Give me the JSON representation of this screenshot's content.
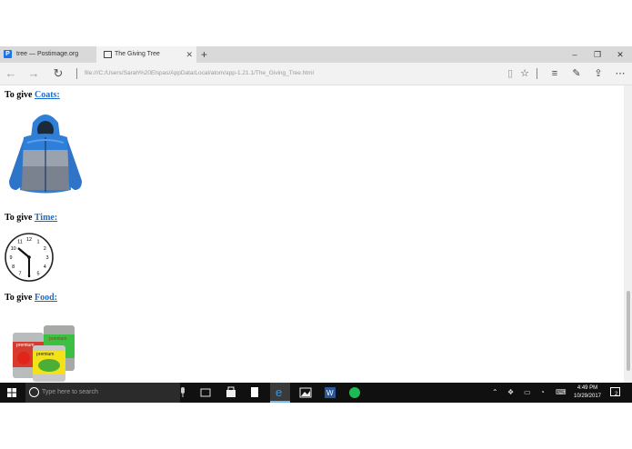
{
  "tabs": [
    {
      "title": "tree — Postimage.org",
      "icon": "postimage-icon"
    },
    {
      "title": "The Giving Tree",
      "icon": "page-icon"
    }
  ],
  "address": {
    "url": "file:///C:/Users/Sarah%20Elspas/AppData/Local/atom/app-1.21.1/The_Giving_Tree.html"
  },
  "sections": [
    {
      "prefix": "To give ",
      "link": "Coats:",
      "image": "coat-image"
    },
    {
      "prefix": "To give ",
      "link": "Time:",
      "image": "clock-image"
    },
    {
      "prefix": "To give ",
      "link": "Food:",
      "image": "canned-food-image"
    }
  ],
  "clock_face": [
    "12",
    "1",
    "2",
    "3",
    "4",
    "5",
    "6",
    "7",
    "8",
    "9",
    "10",
    "11"
  ],
  "can_label": "premium",
  "taskbar": {
    "search_placeholder": "Type here to search",
    "time": "4:49 PM",
    "date": "10/29/2017",
    "notification_count": "2"
  },
  "colors": {
    "link": "#1a6cc8",
    "taskbar": "#101010",
    "accent": "#76b9ed"
  }
}
